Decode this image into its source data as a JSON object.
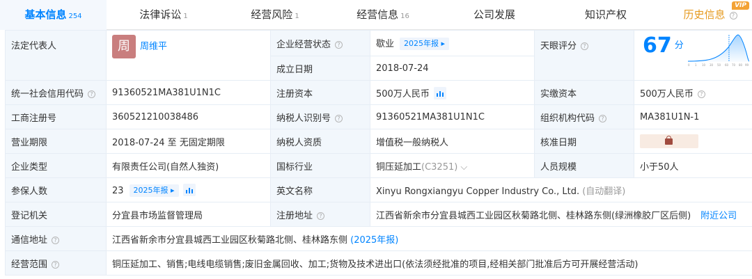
{
  "tabs": [
    {
      "label": "基本信息",
      "count": "254"
    },
    {
      "label": "法律诉讼",
      "count": "1"
    },
    {
      "label": "经营风险",
      "count": "1"
    },
    {
      "label": "经营信息",
      "count": "16"
    },
    {
      "label": "公司发展",
      "count": ""
    },
    {
      "label": "知识产权",
      "count": ""
    },
    {
      "label": "历史信息",
      "count": ""
    }
  ],
  "vip_tag": "VIP",
  "rows": {
    "legal_rep": {
      "label": "法定代表人",
      "avatar_char": "周",
      "name": "周维平"
    },
    "status": {
      "label": "企业经营状态",
      "value": "歇业",
      "badge": "2025年报"
    },
    "founded": {
      "label": "成立日期",
      "value": "2018-07-24"
    },
    "tianyan": {
      "label": "天眼评分",
      "score": "67",
      "unit": "分",
      "ticks": [
        "0",
        "1",
        "10",
        "30",
        "50",
        "60",
        "70",
        "80",
        "99"
      ],
      "score_fraction": 0.67
    },
    "credit_code": {
      "label": "统一社会信用代码",
      "value": "91360521MA381U1N1C"
    },
    "reg_capital": {
      "label": "注册资本",
      "value": "500万人民币"
    },
    "paid_capital": {
      "label": "实缴资本",
      "value": "500万人民币"
    },
    "biz_reg_no": {
      "label": "工商注册号",
      "value": "360521210038486"
    },
    "taxpayer_id": {
      "label": "纳税人识别号",
      "value": "91360521MA381U1N1C"
    },
    "org_code": {
      "label": "组织机构代码",
      "value": "MA381U1N-1"
    },
    "term": {
      "label": "营业期限",
      "value": "2018-07-24 至 无固定期限"
    },
    "tax_qual": {
      "label": "纳税人资质",
      "value": "增值税一般纳税人"
    },
    "approve_date": {
      "label": "核准日期"
    },
    "company_type": {
      "label": "企业类型",
      "value": "有限责任公司(自然人独资)"
    },
    "industry": {
      "label": "国标行业",
      "value": "铜压延加工",
      "code": "(C3251)"
    },
    "staff_size": {
      "label": "人员规模",
      "value": "小于50人"
    },
    "insured": {
      "label": "参保人数",
      "value": "23",
      "badge": "2025年报"
    },
    "english_name": {
      "label": "英文名称",
      "value": "Xinyu Rongxiangyu Copper Industry Co., Ltd.",
      "note": "(自动翻译)"
    },
    "reg_authority": {
      "label": "登记机关",
      "value": "分宜县市场监督管理局"
    },
    "reg_address": {
      "label": "注册地址",
      "value": "江西省新余市分宜县城西工业园区秋菊路北侧、桂林路东侧(绿洲橡胶厂区后侧)",
      "link": "附近公司"
    },
    "contact_address": {
      "label": "通信地址",
      "value": "江西省新余市分宜县城西工业园区秋菊路北侧、桂林路东侧",
      "link": "(2025年报)"
    },
    "business_scope": {
      "label": "经营范围",
      "value": "铜压延加工、销售;电线电缆销售;废旧金属回收、加工;货物及技术进出口(依法须经批准的项目,经相关部门批准后方可开展经营活动)"
    }
  },
  "colors": {
    "accent": "#0084ff",
    "label_bg": "#f2f7fc",
    "border": "#e6edf5",
    "history": "#e69a1f",
    "avatar_bg": "#c97e7e"
  }
}
